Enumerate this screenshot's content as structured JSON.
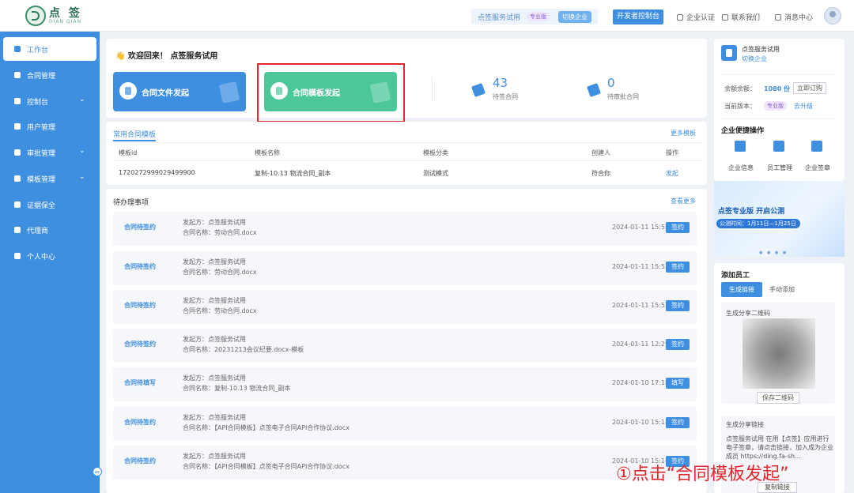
{
  "header": {
    "logo_text": "点 签",
    "logo_sub": "DIAN QIAN",
    "org_name": "点签服务试用",
    "version_badge": "专业版",
    "switch_label": "切换企业",
    "dev_console": "开发者控制台",
    "links": [
      "企业认证",
      "联系我们",
      "消息中心"
    ]
  },
  "sidebar": {
    "items": [
      {
        "label": "工作台",
        "icon": "home-icon",
        "active": true,
        "expand": false
      },
      {
        "label": "合同管理",
        "icon": "contract-icon",
        "active": false,
        "expand": false
      },
      {
        "label": "控制台",
        "icon": "chart-icon",
        "active": false,
        "expand": true
      },
      {
        "label": "用户管理",
        "icon": "user-icon",
        "active": false,
        "expand": false
      },
      {
        "label": "审批管理",
        "icon": "approval-icon",
        "active": false,
        "expand": true
      },
      {
        "label": "模板管理",
        "icon": "send-icon",
        "active": false,
        "expand": true
      },
      {
        "label": "证据保全",
        "icon": "lock-icon",
        "active": false,
        "expand": false
      },
      {
        "label": "代理商",
        "icon": "calendar-icon",
        "active": false,
        "expand": false
      },
      {
        "label": "个人中心",
        "icon": "person-icon",
        "active": false,
        "expand": false
      }
    ],
    "collapse_icon": "⇐"
  },
  "main": {
    "welcome": "👋 欢迎回来！ 点签服务试用",
    "actions": [
      {
        "label": "合同文件发起",
        "color": "#3f8fe0"
      },
      {
        "label": "合同模板发起",
        "color": "#4cc79a"
      }
    ],
    "stats": [
      {
        "value": "43",
        "label": "待签合同"
      },
      {
        "value": "0",
        "label": "待审批合同"
      }
    ],
    "templates": {
      "title": "常用合同模板",
      "more": "更多模板",
      "headers": [
        "模板id",
        "模板名称",
        "模板分类",
        "创建人",
        "操作"
      ],
      "rows": [
        [
          "1720272999029499900",
          "复制-10.13 物流合同_副本",
          "测试模式",
          "符合你",
          "发起"
        ]
      ]
    },
    "todo": {
      "title": "待办理事项",
      "more": "查看更多",
      "items": [
        {
          "status": "合同待签约",
          "sender": "发起方：点签服务试用",
          "name": "合同名称：劳动合同.docx",
          "time": "2024-01-11 15:55",
          "action": "签约"
        },
        {
          "status": "合同待签约",
          "sender": "发起方：点签服务试用",
          "name": "合同名称：劳动合同.docx",
          "time": "2024-01-11 15:53",
          "action": "签约"
        },
        {
          "status": "合同待签约",
          "sender": "发起方：点签服务试用",
          "name": "合同名称：劳动合同.docx",
          "time": "2024-01-11 15:52",
          "action": "签约"
        },
        {
          "status": "合同待签约",
          "sender": "发起方：点签服务试用",
          "name": "合同名称：20231213会议纪要.docx-模板",
          "time": "2024-01-11 12:29",
          "action": "签约"
        },
        {
          "status": "合同待填写",
          "sender": "发起方：点签服务试用",
          "name": "合同名称：复制-10.13 物流合同_副本",
          "time": "2024-01-10 17:18",
          "action": "填写"
        },
        {
          "status": "合同待签约",
          "sender": "发起方：点签服务试用",
          "name": "合同名称：【API合同模板】点签电子合同API合作协议.docx",
          "time": "2024-01-10 15:14",
          "action": "签约"
        },
        {
          "status": "合同待签约",
          "sender": "发起方：点签服务试用",
          "name": "合同名称：【API合同模板】点签电子合同API合作协议.docx",
          "time": "2024-01-10 15:14",
          "action": "签约"
        }
      ]
    }
  },
  "right": {
    "org_name": "点签服务试用",
    "org_sub": "切换企业",
    "balance_label": "余额余额：",
    "balance_value": "1080 份",
    "balance_btn": "立即订购",
    "version_label": "当前版本：",
    "version_badge": "专业版",
    "version_link": "去升级",
    "quick_title": "企业便捷操作",
    "quick_items": [
      "企业信息",
      "员工管理",
      "企业签章"
    ],
    "banner_title": "点签专业版 开启公测",
    "banner_pill": "公测时间：1月11日—1月25日",
    "banner_dots": "● ● ● ●",
    "add_staff_title": "添加员工",
    "tab_generate": "生成链接",
    "tab_manual": "手动添加",
    "qr_title": "生成分享二维码",
    "qr_btn": "保存二维码",
    "share_title": "生成分享链接",
    "share_text": "点签服务试用 在用【点签】应用进行电子签章，请点击链接，加入成为企业成员 https://ding.fa-sh...",
    "share_btn": "复制链接"
  },
  "annotation": "①点击“合同模板发起”"
}
